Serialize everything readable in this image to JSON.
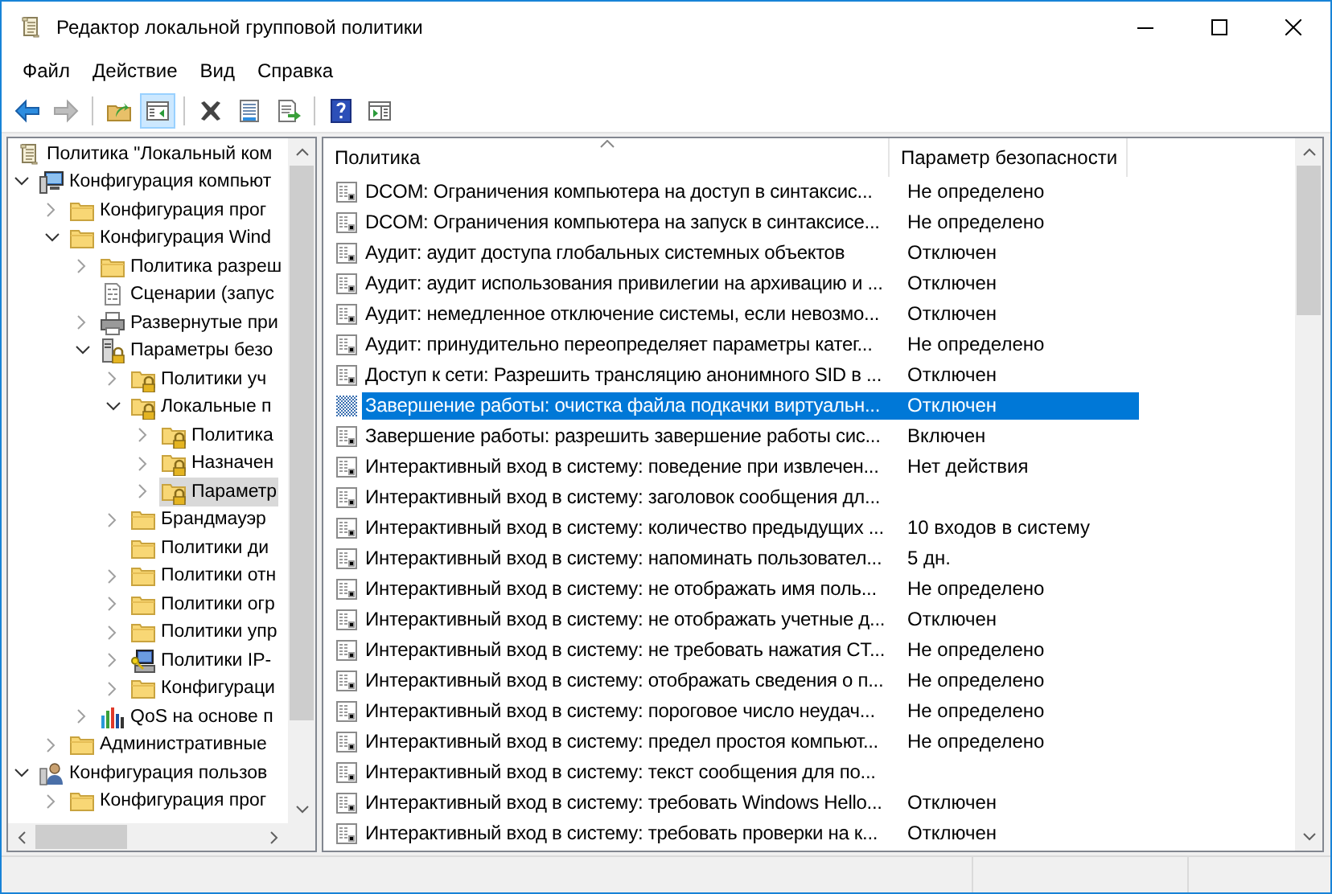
{
  "window": {
    "title": "Редактор локальной групповой политики"
  },
  "menu": [
    "Файл",
    "Действие",
    "Вид",
    "Справка"
  ],
  "toolbar": [
    [
      {
        "disabled": false,
        "pressed": false
      },
      {
        "disabled": true,
        "pressed": false
      }
    ],
    [
      {
        "disabled": false,
        "pressed": false
      },
      {
        "disabled": false,
        "pressed": true
      }
    ],
    [
      {
        "disabled": false,
        "pressed": false
      },
      {
        "disabled": false,
        "pressed": false
      },
      {
        "disabled": false,
        "pressed": false
      }
    ],
    [
      {
        "disabled": false,
        "pressed": false
      },
      {
        "disabled": false,
        "pressed": false
      }
    ]
  ],
  "tree": [
    {
      "label": "Политика \"Локальный ком",
      "kind": "root",
      "selected": false,
      "children": [
        {
          "label": "Конфигурация компьют",
          "kind": "computer",
          "expanded": true,
          "selected": false,
          "children": [
            {
              "label": "Конфигурация прог",
              "kind": "folder",
              "expanded": false,
              "selected": false
            },
            {
              "label": "Конфигурация Wind",
              "kind": "folder",
              "expanded": true,
              "selected": false,
              "children": [
                {
                  "label": "Политика разреш",
                  "kind": "folder",
                  "expanded": false,
                  "selected": false
                },
                {
                  "label": "Сценарии (запус",
                  "kind": "script",
                  "selected": false
                },
                {
                  "label": "Развернутые при",
                  "kind": "printer",
                  "expanded": false,
                  "selected": false
                },
                {
                  "label": "Параметры безо",
                  "kind": "security",
                  "expanded": true,
                  "selected": false,
                  "children": [
                    {
                      "label": "Политики уч",
                      "kind": "lockfolder",
                      "expanded": false,
                      "selected": false
                    },
                    {
                      "label": "Локальные п",
                      "kind": "lockfolder",
                      "expanded": true,
                      "selected": false,
                      "children": [
                        {
                          "label": "Политика",
                          "kind": "lockfolder",
                          "expanded": false,
                          "selected": false
                        },
                        {
                          "label": "Назначен",
                          "kind": "lockfolder",
                          "expanded": false,
                          "selected": false
                        },
                        {
                          "label": "Параметр",
                          "kind": "lockfolder",
                          "expanded": false,
                          "selected": true
                        }
                      ]
                    },
                    {
                      "label": "Брандмауэр",
                      "kind": "folder",
                      "expanded": false,
                      "selected": false
                    },
                    {
                      "label": "Политики ди",
                      "kind": "folder",
                      "selected": false
                    },
                    {
                      "label": "Политики отн",
                      "kind": "folder",
                      "expanded": false,
                      "selected": false
                    },
                    {
                      "label": "Политики огр",
                      "kind": "folder",
                      "expanded": false,
                      "selected": false
                    },
                    {
                      "label": "Политики упр",
                      "kind": "folder",
                      "expanded": false,
                      "selected": false
                    },
                    {
                      "label": "Политики IP-",
                      "kind": "ipsec",
                      "expanded": false,
                      "selected": false
                    },
                    {
                      "label": "Конфигураци",
                      "kind": "folder",
                      "expanded": false,
                      "selected": false
                    }
                  ]
                },
                {
                  "label": "QoS на основе п",
                  "kind": "chart",
                  "expanded": false,
                  "selected": false
                }
              ]
            },
            {
              "label": "Административные",
              "kind": "folder",
              "expanded": false,
              "selected": false
            }
          ]
        },
        {
          "label": "Конфигурация пользов",
          "kind": "user",
          "expanded": true,
          "selected": false,
          "children": [
            {
              "label": "Конфигурация прог",
              "kind": "folder",
              "expanded": false,
              "selected": false
            }
          ]
        }
      ]
    }
  ],
  "table": {
    "columns": [
      "Политика",
      "Параметр безопасности"
    ],
    "rows": [
      {
        "policy": "DCOM: Ограничения компьютера на доступ в синтаксис...",
        "value": "Не определено",
        "selected": false
      },
      {
        "policy": "DCOM: Ограничения компьютера на запуск в синтаксисе...",
        "value": "Не определено",
        "selected": false
      },
      {
        "policy": "Аудит: аудит доступа глобальных системных объектов",
        "value": "Отключен",
        "selected": false
      },
      {
        "policy": "Аудит: аудит использования привилегии на архивацию и ...",
        "value": "Отключен",
        "selected": false
      },
      {
        "policy": "Аудит: немедленное отключение системы, если невозмо...",
        "value": "Отключен",
        "selected": false
      },
      {
        "policy": "Аудит: принудительно переопределяет параметры катег...",
        "value": "Не определено",
        "selected": false
      },
      {
        "policy": "Доступ к сети: Разрешить трансляцию анонимного SID в ...",
        "value": "Отключен",
        "selected": false
      },
      {
        "policy": "Завершение работы: очистка файла подкачки виртуальн...",
        "value": "Отключен",
        "selected": true
      },
      {
        "policy": "Завершение работы: разрешить завершение работы сис...",
        "value": "Включен",
        "selected": false
      },
      {
        "policy": "Интерактивный вход в систему:  поведение при извлечен...",
        "value": "Нет действия",
        "selected": false
      },
      {
        "policy": "Интерактивный вход в систему: заголовок сообщения дл...",
        "selected": false
      },
      {
        "policy": "Интерактивный вход в систему: количество предыдущих ...",
        "value": "10 входов в систему",
        "selected": false
      },
      {
        "policy": "Интерактивный вход в систему: напоминать пользовател...",
        "value": "5 дн.",
        "selected": false
      },
      {
        "policy": "Интерактивный вход в систему: не отображать имя поль...",
        "value": "Не определено",
        "selected": false
      },
      {
        "policy": "Интерактивный вход в систему: не отображать учетные д...",
        "value": "Отключен",
        "selected": false
      },
      {
        "policy": "Интерактивный вход в систему: не требовать нажатия CT...",
        "value": "Не определено",
        "selected": false
      },
      {
        "policy": "Интерактивный вход в систему: отображать сведения о п...",
        "value": "Не определено",
        "selected": false
      },
      {
        "policy": "Интерактивный вход в систему: пороговое число неудач...",
        "value": "Не определено",
        "selected": false
      },
      {
        "policy": "Интерактивный вход в систему: предел простоя компьют...",
        "value": "Не определено",
        "selected": false
      },
      {
        "policy": "Интерактивный вход в систему: текст сообщения для по...",
        "selected": false
      },
      {
        "policy": "Интерактивный вход в систему: требовать Windows Hello...",
        "value": "Отключен",
        "selected": false
      },
      {
        "policy": "Интерактивный вход в систему: требовать проверки на к...",
        "value": "Отключен",
        "selected": false
      }
    ]
  }
}
